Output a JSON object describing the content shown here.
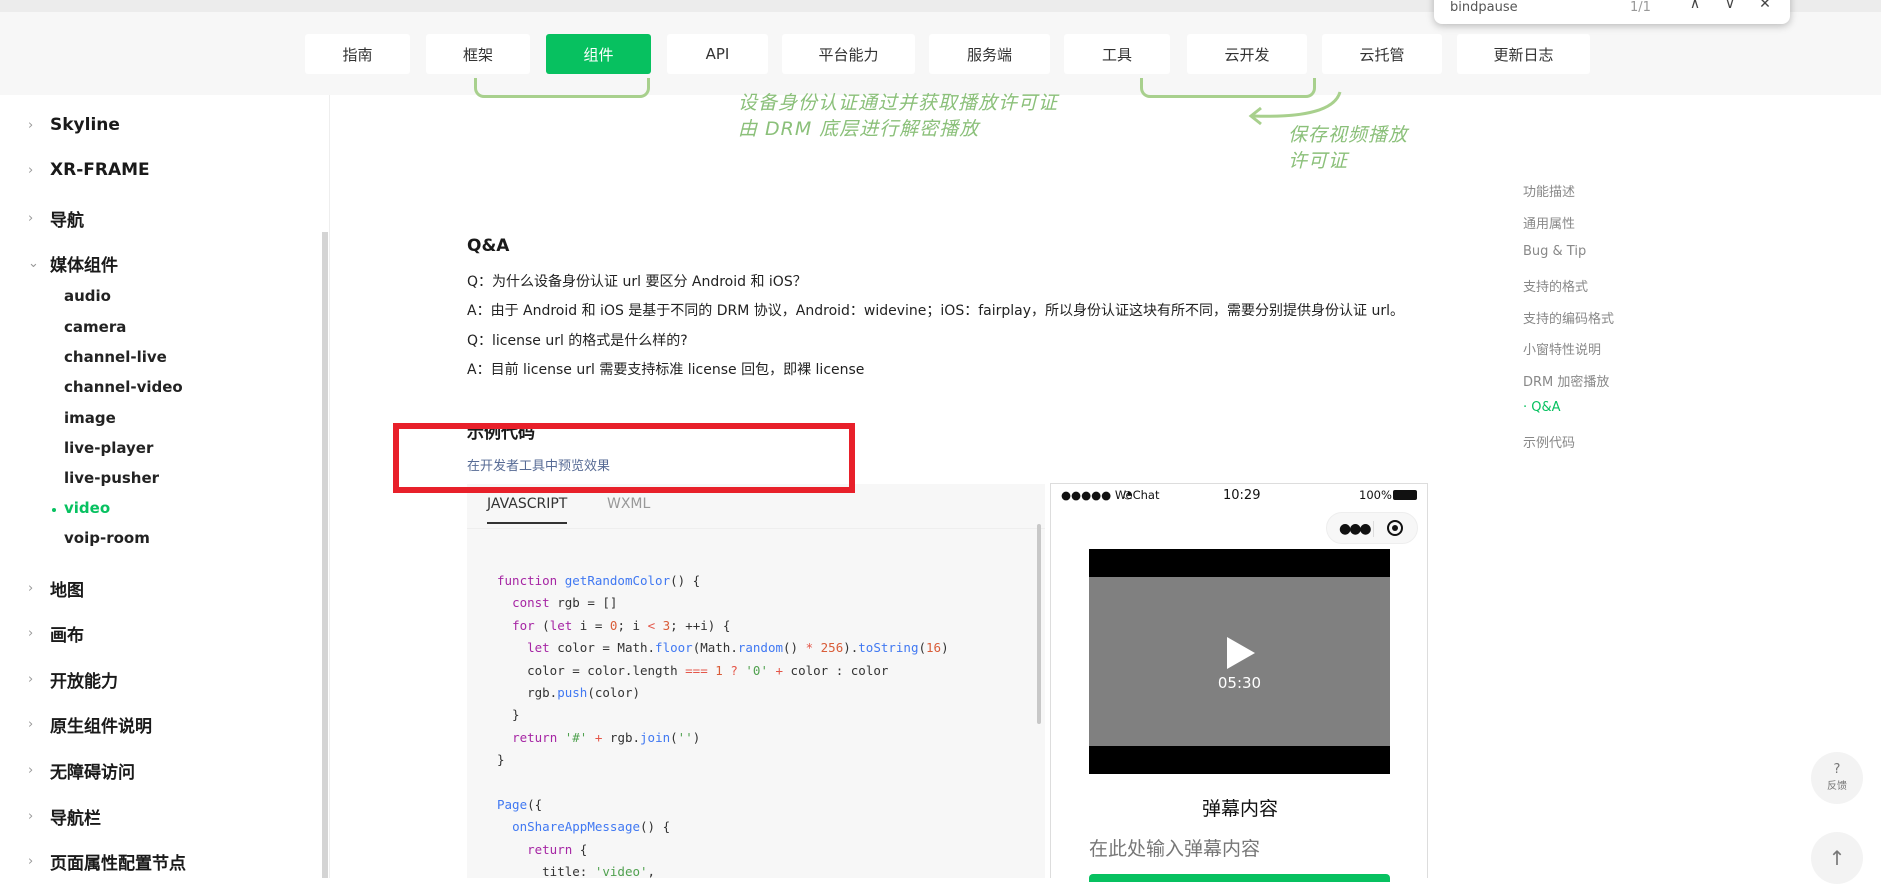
{
  "findbar": {
    "query": "bindpause",
    "count": "1/1",
    "up": "∧",
    "down": "∨",
    "close": "✕"
  },
  "topnav": {
    "items": [
      "指南",
      "框架",
      "组件",
      "API",
      "平台能力",
      "服务端",
      "工具",
      "云开发",
      "云托管",
      "更新日志"
    ],
    "active": "组件"
  },
  "sidebar": {
    "groups": [
      "Skyline",
      "XR-FRAME",
      "导航",
      "媒体组件"
    ],
    "media_items": [
      "audio",
      "camera",
      "channel-live",
      "channel-video",
      "image",
      "live-player",
      "live-pusher",
      "video",
      "voip-room"
    ],
    "active_item": "video",
    "more_groups": [
      "地图",
      "画布",
      "开放能力",
      "原生组件说明",
      "无障碍访问",
      "导航栏",
      "页面属性配置节点"
    ]
  },
  "diagram": {
    "text1_line1": "设备身份认证通过并获取播放许可证",
    "text1_line2": "由 DRM 底层进行解密播放",
    "text2_line1": "保存视频播放",
    "text2_line2": "许可证"
  },
  "content": {
    "qa_heading": "Q&A",
    "q1": "Q：为什么设备身份认证 url 要区分 Android 和 iOS？",
    "a1": "A：由于 Android 和 iOS 是基于不同的 DRM 协议，Android：widevine；iOS：fairplay，所以身份认证这块有所不同，需要分别提供身份认证 url。",
    "q2": "Q：license url 的格式是什么样的?",
    "a2": "A：目前 license url 需要支持标准 license 回包，即裸 license",
    "example_heading": "示例代码",
    "preview_link": "在开发者工具中预览效果"
  },
  "code": {
    "tabs": [
      "JAVASCRIPT",
      "WXML"
    ],
    "active_tab": "JAVASCRIPT"
  },
  "phone": {
    "carrier": "●●●●● WeChat",
    "time": "10:29",
    "battery": "100%",
    "duration": "05:30",
    "danmu_title": "弹幕内容",
    "danmu_placeholder": "在此处输入弹幕内容"
  },
  "toc": {
    "items": [
      "功能描述",
      "通用属性",
      "Bug & Tip",
      "支持的格式",
      "支持的编码格式",
      "小窗特性说明",
      "DRM 加密播放",
      "· Q&A",
      "示例代码"
    ],
    "active": "· Q&A"
  },
  "floating": {
    "feedback_label": "反馈",
    "feedback_icon": "?",
    "top_icon": "↑"
  },
  "colors": {
    "accent": "#07c160",
    "highlight": "#e8202a",
    "link": "#576b95",
    "diagram": "#8bc07a"
  }
}
